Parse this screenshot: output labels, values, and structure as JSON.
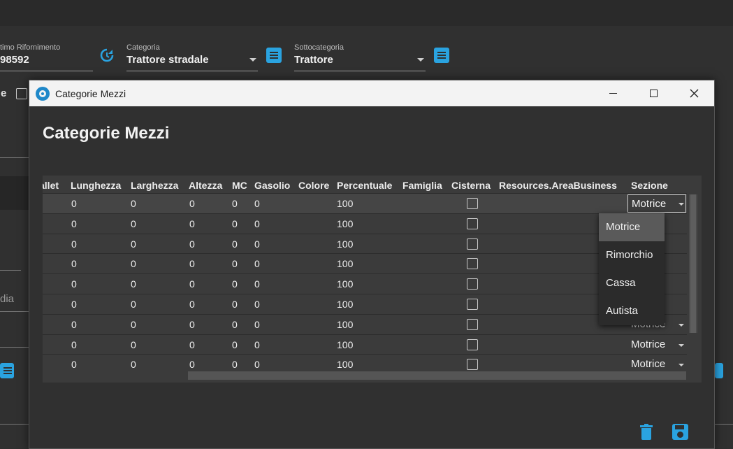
{
  "background": {
    "fields": [
      {
        "label": "timo Rifornimento",
        "value": "98592"
      },
      {
        "label": "Categoria",
        "value": "Trattore stradale"
      },
      {
        "label": "Sottocategoria",
        "value": "Trattore"
      }
    ],
    "left_letter": "e",
    "left_text_dia": "dia"
  },
  "dialog": {
    "window_title": "Categorie Mezzi",
    "heading": "Categorie Mezzi",
    "columns": [
      "allet",
      "Lunghezza",
      "Larghezza",
      "Altezza",
      "MC",
      "Gasolio",
      "Colore",
      "Percentuale",
      "Famiglia",
      "Cisterna",
      "Resources.AreaBusiness",
      "Sezione"
    ],
    "rows": [
      {
        "lunghezza": "0",
        "larghezza": "0",
        "altezza": "0",
        "mc": "0",
        "gasolio": "0",
        "percentuale": "100",
        "sezione": "Motrice"
      },
      {
        "lunghezza": "0",
        "larghezza": "0",
        "altezza": "0",
        "mc": "0",
        "gasolio": "0",
        "percentuale": "100",
        "sezione": ""
      },
      {
        "lunghezza": "0",
        "larghezza": "0",
        "altezza": "0",
        "mc": "0",
        "gasolio": "0",
        "percentuale": "100",
        "sezione": ""
      },
      {
        "lunghezza": "0",
        "larghezza": "0",
        "altezza": "0",
        "mc": "0",
        "gasolio": "0",
        "percentuale": "100",
        "sezione": ""
      },
      {
        "lunghezza": "0",
        "larghezza": "0",
        "altezza": "0",
        "mc": "0",
        "gasolio": "0",
        "percentuale": "100",
        "sezione": ""
      },
      {
        "lunghezza": "0",
        "larghezza": "0",
        "altezza": "0",
        "mc": "0",
        "gasolio": "0",
        "percentuale": "100",
        "sezione": ""
      },
      {
        "lunghezza": "0",
        "larghezza": "0",
        "altezza": "0",
        "mc": "0",
        "gasolio": "0",
        "percentuale": "100",
        "sezione": "Motrice"
      },
      {
        "lunghezza": "0",
        "larghezza": "0",
        "altezza": "0",
        "mc": "0",
        "gasolio": "0",
        "percentuale": "100",
        "sezione": "Motrice"
      },
      {
        "lunghezza": "0",
        "larghezza": "0",
        "altezza": "0",
        "mc": "0",
        "gasolio": "0",
        "percentuale": "100",
        "sezione": "Motrice"
      }
    ],
    "dropdown_options": [
      "Motrice",
      "Rimorchio",
      "Cassa",
      "Autista"
    ],
    "dropdown_selected": "Motrice",
    "icons": {
      "delete": "trash-icon",
      "save": "save-icon",
      "refresh": "refresh-icon",
      "list": "list-icon"
    },
    "accent_color": "#2aa3e0"
  }
}
